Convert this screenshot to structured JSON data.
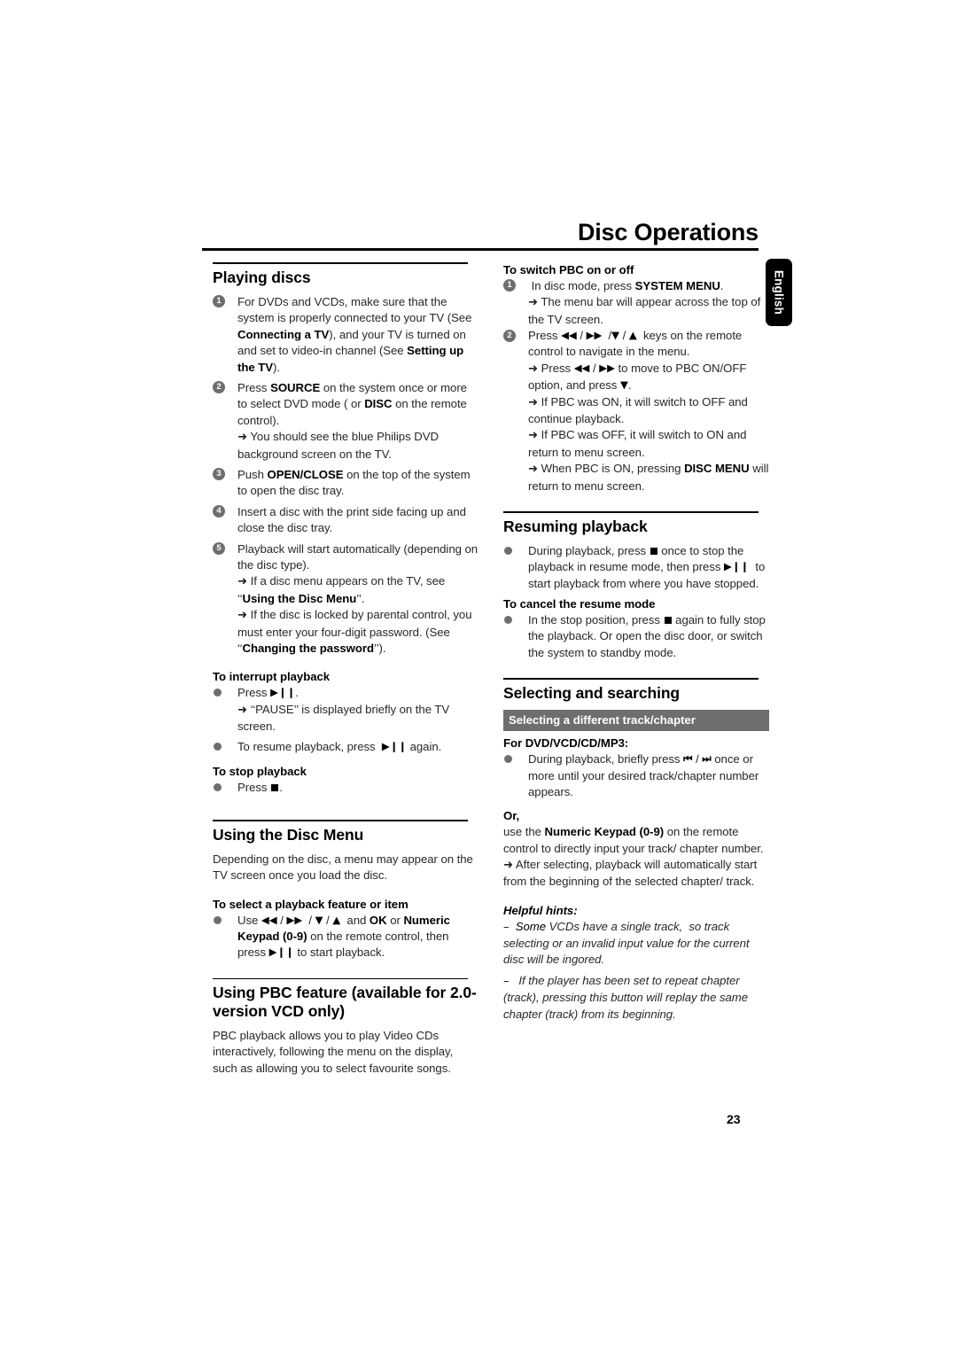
{
  "document": {
    "header_title": "Disc Operations",
    "language_tab": "English",
    "page_number": "23"
  },
  "left_column": {
    "sections": [
      {
        "title": "Playing discs",
        "steps": [
          {
            "num": "1",
            "text": "For DVDs and VCDs, make sure that the system is properly connected to your TV (See Connecting a TV), and your TV is turned on and set to video-in channel (See Setting up the TV)."
          },
          {
            "num": "2",
            "text": "Press SOURCE on the system once or more to select DVD mode ( or DISC on the remote control)."
          },
          {
            "num": "2b",
            "text": "➜ You should see the blue Philips DVD background screen on the TV."
          },
          {
            "num": "3",
            "text": "Push OPEN/CLOSE on the top of the system to open the disc tray."
          },
          {
            "num": "4",
            "text": "Insert a disc with the print side facing up and close the disc tray."
          },
          {
            "num": "5",
            "text": "Playback will start automatically (depending on the disc type)."
          },
          {
            "num": "5b",
            "text": "➜ If a disc menu appears on the TV, see \"Using the Disc Menu\"."
          },
          {
            "num": "5c",
            "text": "➜ If the disc is locked by parental control, you must enter your four-digit password. (See \"Changing the password\")."
          }
        ],
        "subheads": [
          {
            "label": "To interrupt playback",
            "bullets": [
              "Press ▶ ❙❙.",
              "➜ \"PAUSE\" is displayed briefly on the TV screen.",
              "To resume playback, press ▶ ❙❙ again."
            ]
          },
          {
            "label": "To stop playback",
            "bullets": [
              "Press ■."
            ]
          }
        ]
      },
      {
        "title": "Using the Disc Menu",
        "intro": "Depending on the disc, a menu may appear on the TV screen once you load the disc.",
        "subheads": [
          {
            "label": "To select a playback feature or item",
            "bullets": [
              "Use ◀◀ / ▶▶ / ▼ / ▲ and OK or Numeric Keypad (0-9) on the remote control, then press ▶ ❙❙ to start playback."
            ]
          }
        ]
      },
      {
        "title": "Using PBC feature (available for 2.0-version VCD only)",
        "intro": "PBC playback allows you to play Video CDs interactively, following the menu on the display, such as allowing you to select favourite songs."
      }
    ]
  },
  "right_column": {
    "pbc": {
      "subhead": "To switch PBC on or off",
      "steps": [
        {
          "num": "1",
          "text": "In disc mode, press SYSTEM MENU."
        },
        {
          "arrow": "➜ The menu bar will appear across the top of the TV screen."
        },
        {
          "num": "2",
          "text": "Press ◀◀ / ▶▶ /▼ / ▲ keys on the remote control to navigate in the menu."
        },
        {
          "arrow": "➜ Press ◀◀ / ▶▶ to move to PBC ON/OFF option, and press ▼."
        },
        {
          "arrow": "➜ If PBC was ON, it will switch to OFF and continue playback."
        },
        {
          "arrow": "➜ If PBC was OFF, it will switch to ON and return to menu screen."
        },
        {
          "arrow": "➜ When PBC is ON, pressing DISC MENU will return to menu screen."
        }
      ]
    },
    "sections": [
      {
        "title": "Resuming playback",
        "bullets": [
          "During playback, press ■ once to stop the playback in resume mode, then press ▶ ❙❙ to start playback from where you have stopped."
        ],
        "subheads": [
          {
            "label": "To cancel the resume mode",
            "bullets": [
              "In the stop position, press ■ again to fully stop the playback. Or open the disc door, or switch the system to standby mode."
            ]
          }
        ]
      },
      {
        "title": "Selecting and searching",
        "banner": "Selecting a different track/chapter",
        "subheads": [
          {
            "label": "For DVD/VCD/CD/MP3:",
            "bullets": [
              "During playback, briefly press ⏮ / ⏭ once or more until your desired track/chapter number appears."
            ]
          },
          {
            "label": "Or,",
            "paras": [
              "use the Numeric Keypad (0-9) on the remote control to directly input your track/chapter number.",
              "➜ After selecting, playback will automatically start from the beginning of the selected chapter/ track."
            ]
          }
        ],
        "hints": {
          "label": "Helpful hints:",
          "items": [
            "–  Some VCDs have a single track, so track selecting or an invalid input value for the current disc will be ingored.",
            "–   If the player has been set to repeat chapter (track), pressing this button will replay the same chapter (track) from its beginning."
          ]
        }
      }
    ]
  }
}
